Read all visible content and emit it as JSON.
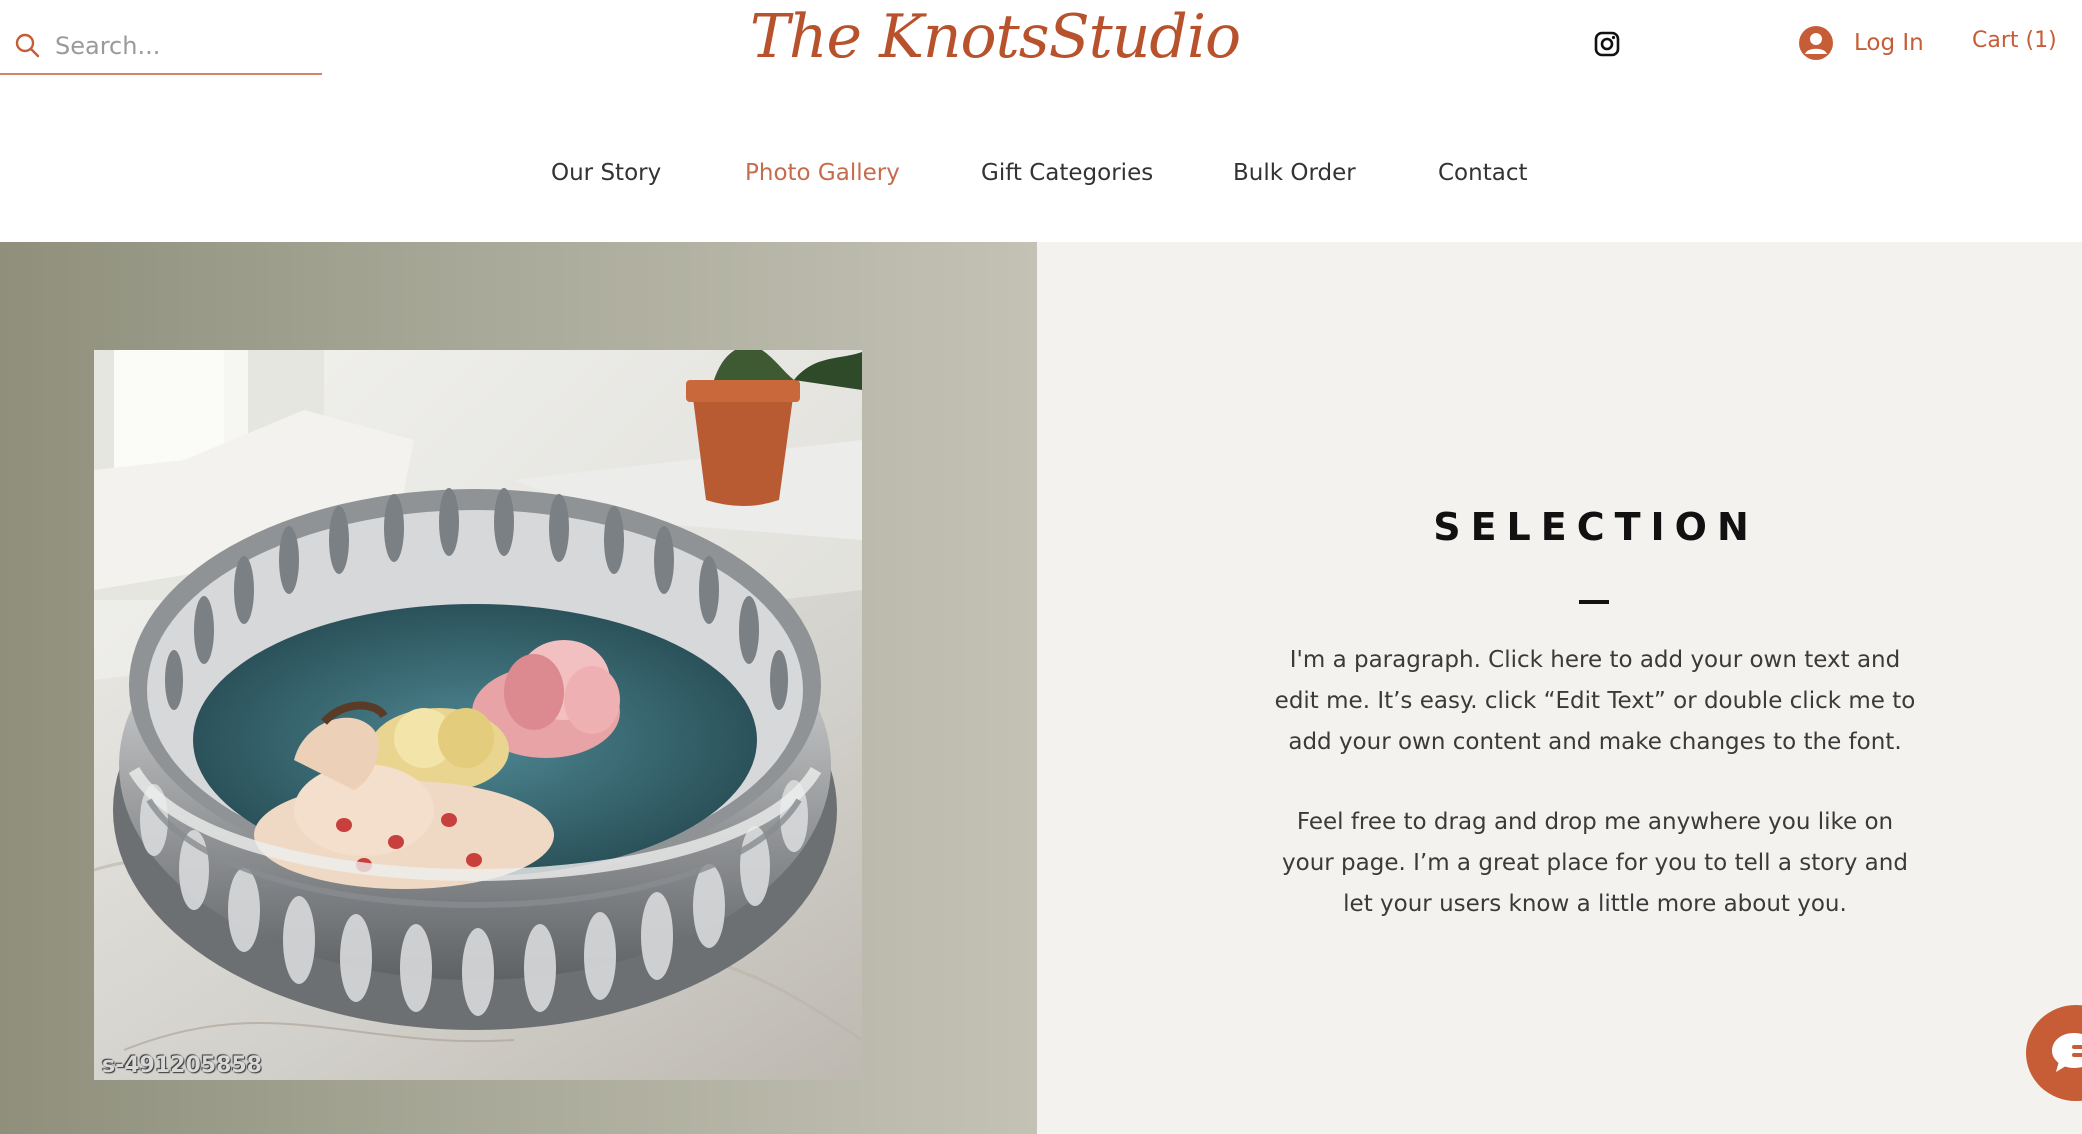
{
  "header": {
    "search_placeholder": "Search...",
    "logo": "The KnotsStudio",
    "login_label": "Log In",
    "cart_label": "Cart (1)"
  },
  "nav": {
    "items": [
      {
        "label": "Our Story",
        "active": false
      },
      {
        "label": "Photo Gallery",
        "active": true
      },
      {
        "label": "Gift Categories",
        "active": false
      },
      {
        "label": "Bulk Order",
        "active": false
      },
      {
        "label": "Contact",
        "active": false
      }
    ]
  },
  "gallery": {
    "photo_code": "s-491205858"
  },
  "selection": {
    "title": "SELECTION",
    "paragraph1": "I'm a paragraph. Click here to add your own text and edit me. It’s easy. click “Edit Text” or double click me to add your own content and make changes to the font.",
    "paragraph2": "Feel free to drag and drop me anywhere you like on your page. I’m a great place for you to tell a story and let your users know a little more about you."
  },
  "colors": {
    "accent": "#c65d36",
    "logo": "#b8522d",
    "nav_active": "#c66c4d",
    "panel_bg": "#f4f2ee"
  },
  "icons": {
    "search": "search-icon",
    "instagram": "instagram-icon",
    "account": "account-avatar-icon",
    "chat": "chat-icon"
  }
}
